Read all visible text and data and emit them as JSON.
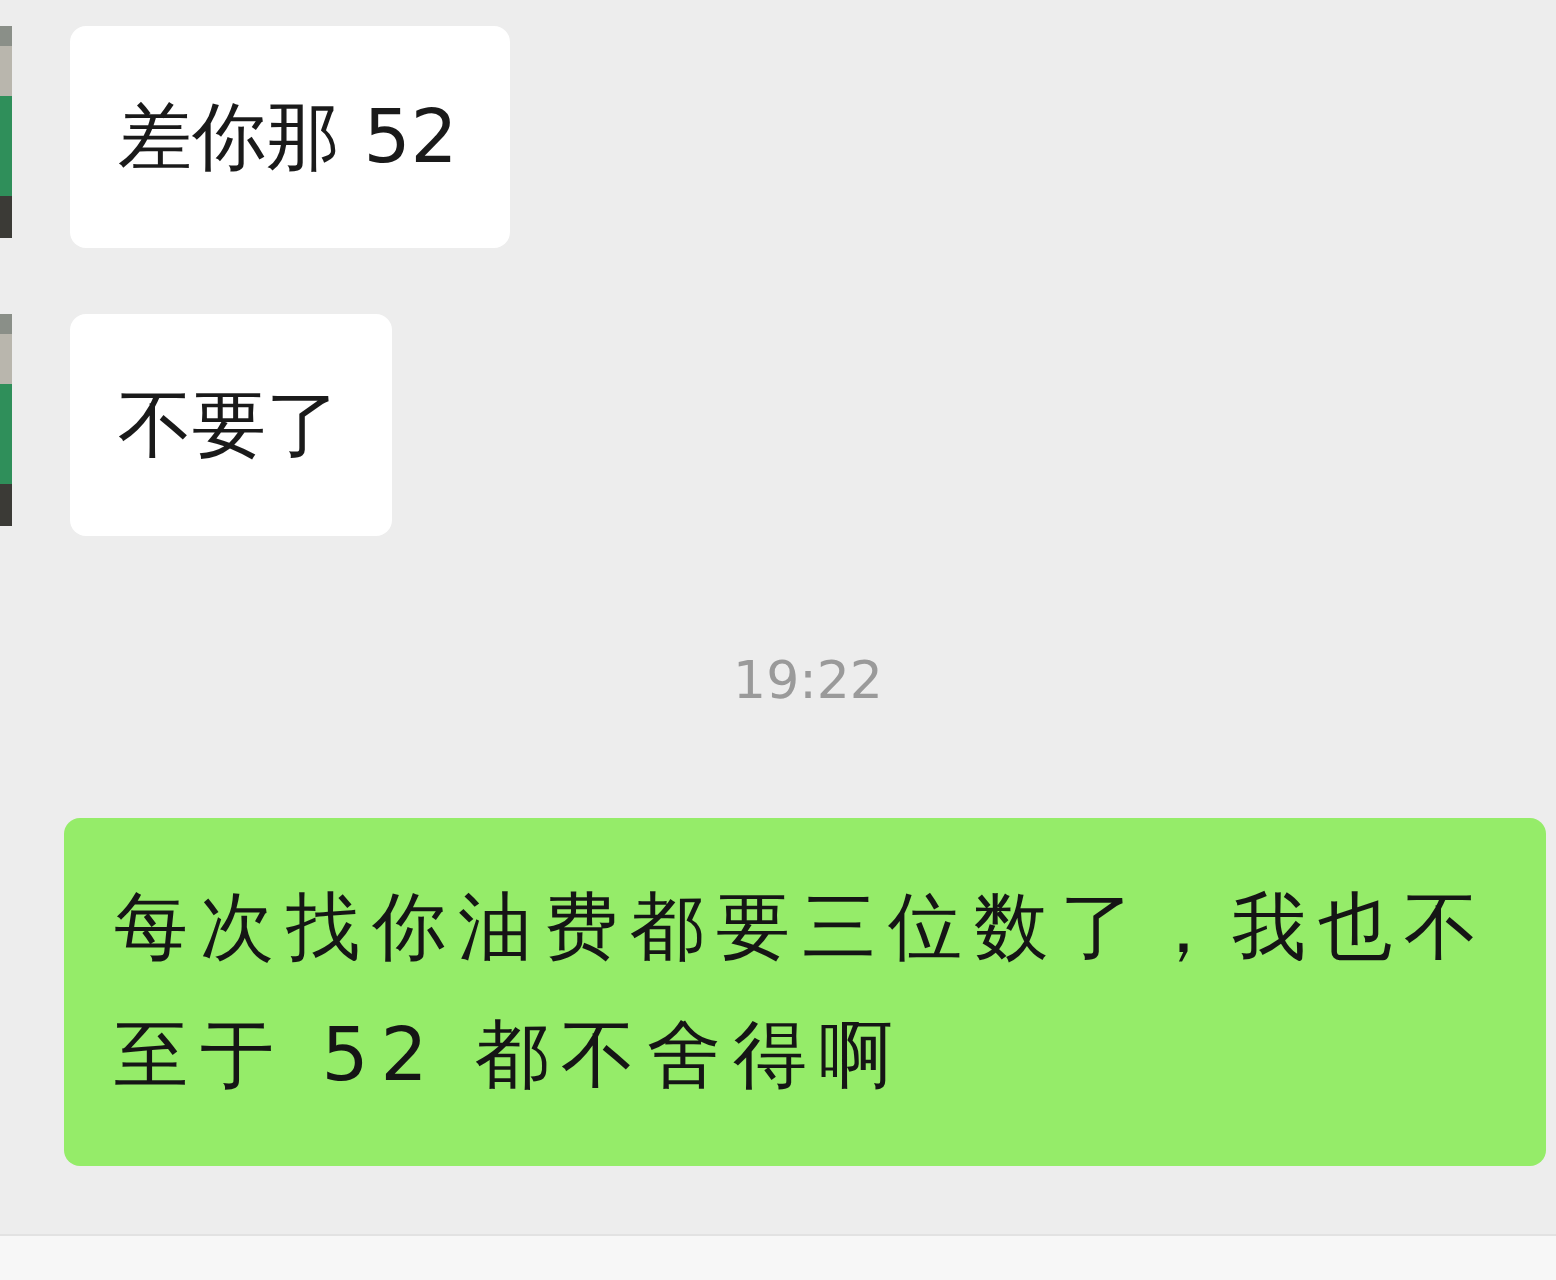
{
  "messages": [
    {
      "kind": "received",
      "text": "差你那 52"
    },
    {
      "kind": "received",
      "text": "不要了"
    },
    {
      "kind": "time",
      "text": "19:22"
    },
    {
      "kind": "sent",
      "text": "每次找你油费都要三位数了，我也不至于 52 都不舍得啊"
    }
  ]
}
